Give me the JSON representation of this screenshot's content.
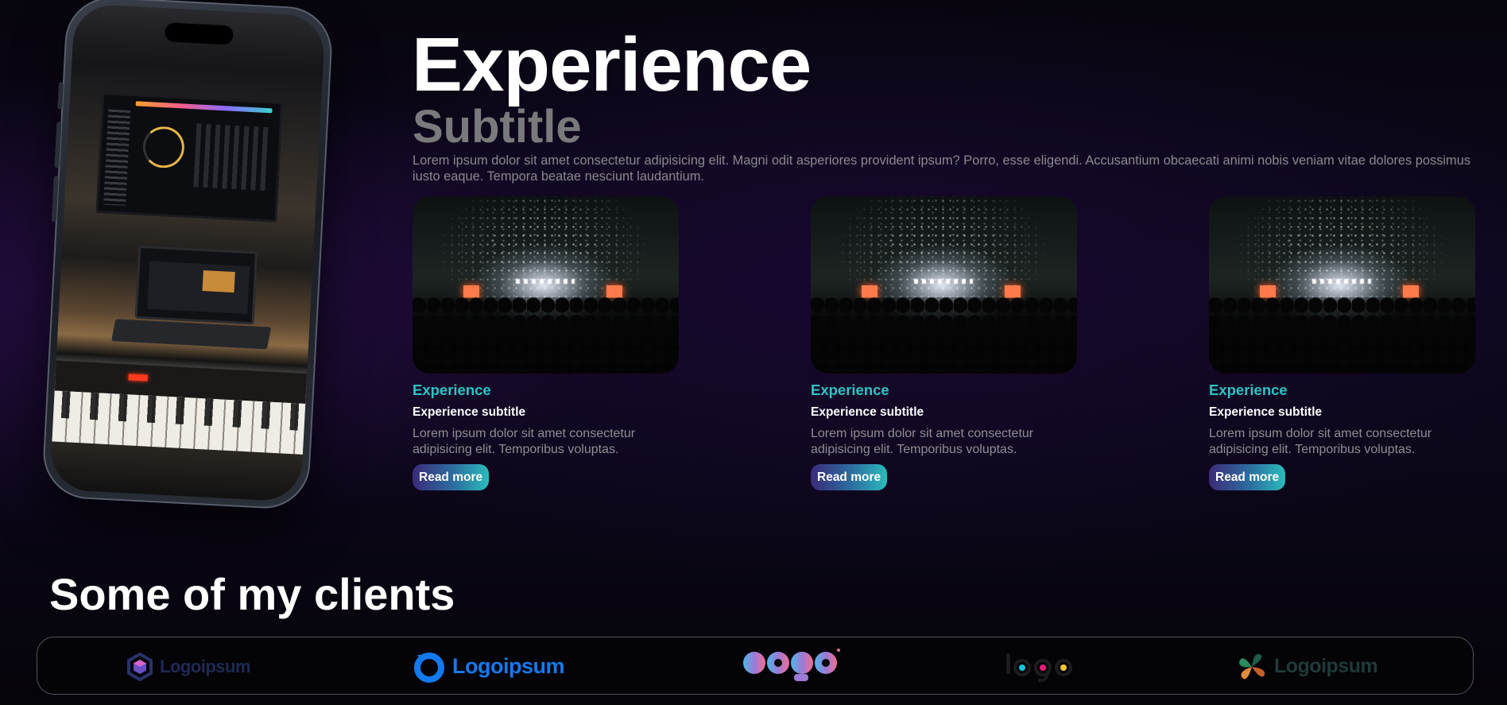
{
  "hero": {
    "title": "Experience",
    "subtitle": "Subtitle",
    "description": "Lorem ipsum dolor sit amet consectetur adipisicing elit. Magni odit asperiores provident ipsum? Porro, esse eligendi. Accusantium obcaecati animi nobis veniam vitae dolores possimus iusto eaque. Tempora beatae nesciunt laudantium."
  },
  "cards": [
    {
      "title": "Experience",
      "subtitle": "Experience subtitle",
      "description": "Lorem ipsum dolor sit amet consectetur adipisicing elit. Temporibus voluptas.",
      "button": "Read more"
    },
    {
      "title": "Experience",
      "subtitle": "Experience subtitle",
      "description": "Lorem ipsum dolor sit amet consectetur adipisicing elit. Temporibus voluptas.",
      "button": "Read more"
    },
    {
      "title": "Experience",
      "subtitle": "Experience subtitle",
      "description": "Lorem ipsum dolor sit amet consectetur adipisicing elit. Temporibus voluptas.",
      "button": "Read more"
    }
  ],
  "clients": {
    "title": "Some of my clients",
    "logos": [
      {
        "name": "Logoipsum",
        "icon": "hexagon-logo-icon",
        "color": "#1e2a55"
      },
      {
        "name": "Logoipsum",
        "icon": "ring-logo-icon",
        "color": "#1479f0"
      },
      {
        "name": "logo",
        "icon": "gradient-wordmark-logo-icon",
        "color": "#c770b4"
      },
      {
        "name": "logo",
        "icon": "dots-wordmark-logo-icon",
        "color": "#1b1b1d"
      },
      {
        "name": "Logoipsum",
        "icon": "leaf-cluster-logo-icon",
        "color": "#1f3a3a"
      }
    ]
  },
  "colors": {
    "accent": "#2ec4c4",
    "button_gradient_start": "#3b2a7a",
    "button_gradient_end": "#2bbcbc",
    "background": "#0f0820"
  }
}
